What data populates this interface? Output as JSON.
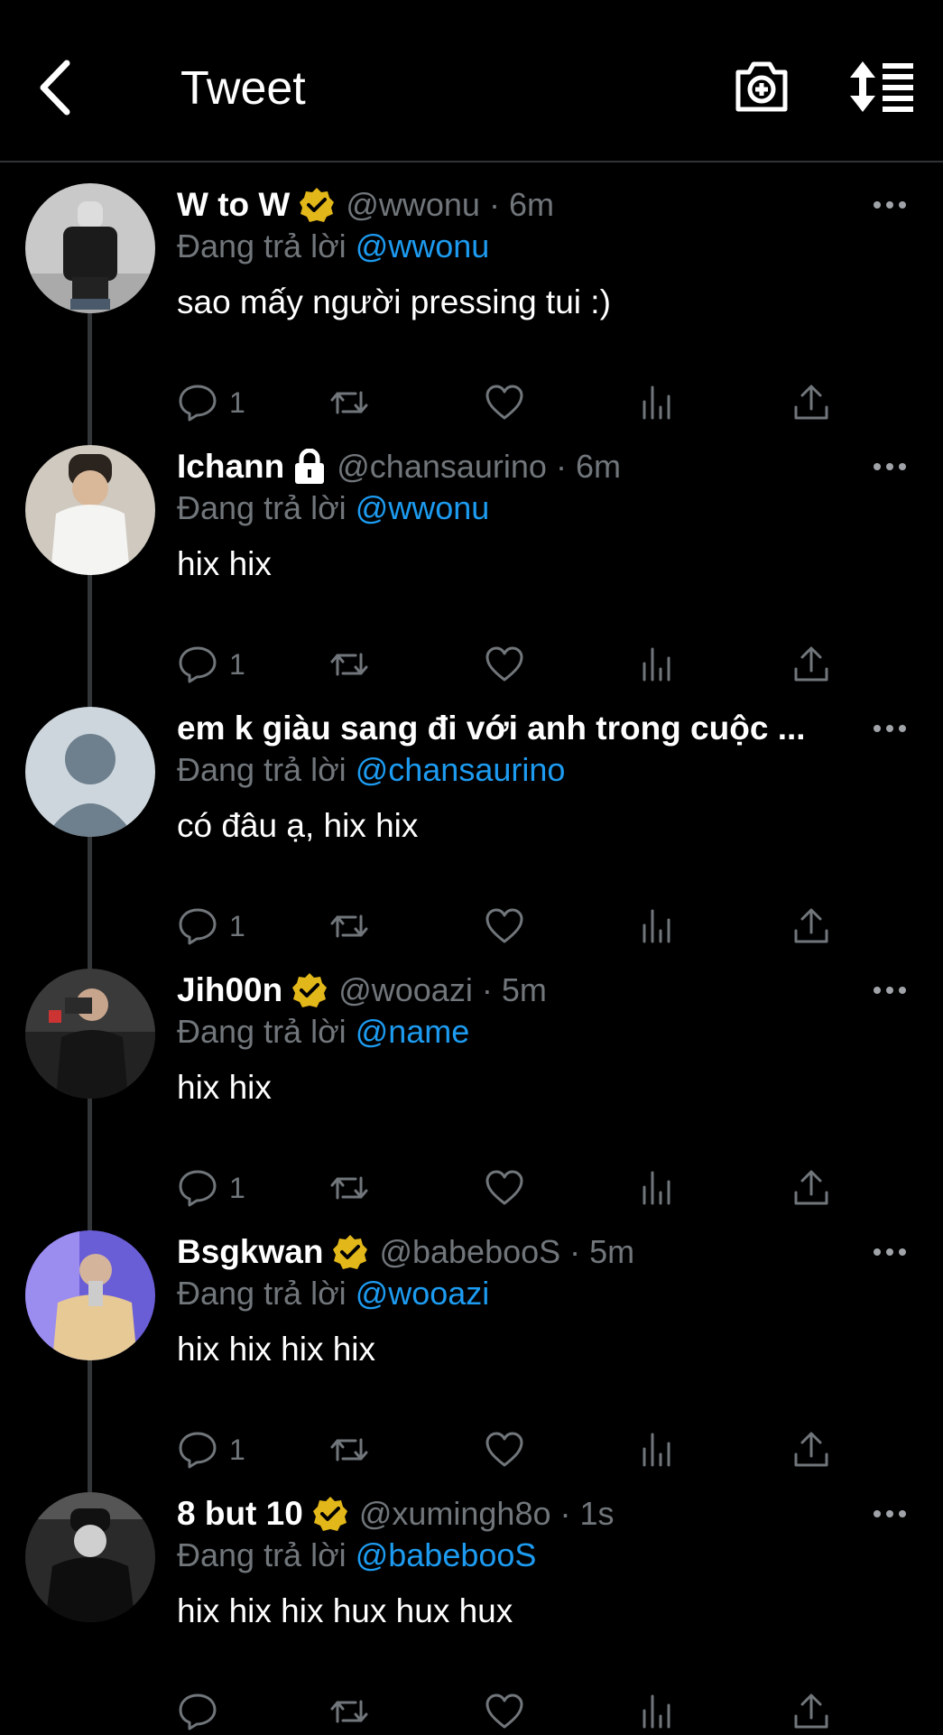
{
  "header": {
    "title": "Tweet",
    "back_icon": "chevron-left-icon",
    "camera_icon": "camera-plus-icon",
    "sort_icon": "sort-list-icon"
  },
  "colors": {
    "background": "#000000",
    "accent": "#1d9bf0",
    "muted": "#71767b",
    "verified": "#e2b719"
  },
  "replying_label": "Đang trả lời",
  "tweets": [
    {
      "name": "W to W",
      "badge": "verified",
      "handle": "@wwonu",
      "time": "6m",
      "reply_to": "@wwonu",
      "text": "sao mấy người pressing tui :)",
      "reply_count": "1"
    },
    {
      "name": "Ichann",
      "badge": "lock",
      "handle": "@chansaurino",
      "time": "6m",
      "reply_to": "@wwonu",
      "text": "hix hix",
      "reply_count": "1"
    },
    {
      "name": "em k giàu sang đi với anh trong cuộc ...",
      "badge": "none",
      "handle": "",
      "time": "",
      "reply_to": "@chansaurino",
      "text": "có đâu ạ, hix hix",
      "reply_count": "1"
    },
    {
      "name": "Jih00n",
      "badge": "verified",
      "handle": "@wooazi",
      "time": "5m",
      "reply_to": "@name",
      "text": "hix hix",
      "reply_count": "1"
    },
    {
      "name": "Bsgkwan",
      "badge": "verified",
      "handle": "@babebooS",
      "time": "5m",
      "reply_to": "@wooazi",
      "text": "hix hix hix hix",
      "reply_count": "1"
    },
    {
      "name": "8 but 10",
      "badge": "verified",
      "handle": "@xumingh8o",
      "time": "1s",
      "reply_to": "@babebooS",
      "text": "hix hix hix hux hux hux",
      "reply_count": ""
    }
  ]
}
